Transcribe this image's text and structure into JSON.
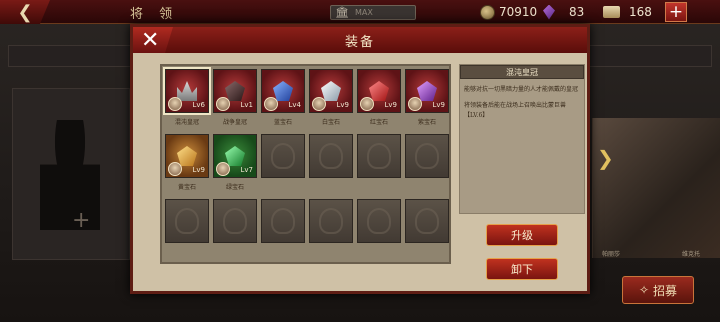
{
  "topbar": {
    "back_icon": "back-arrow-icon",
    "title": "将 领",
    "capacity_text": "MAX",
    "resources": {
      "coins": "70910",
      "gems": "83",
      "scrolls": "168"
    },
    "add_label": "+"
  },
  "background": {
    "add_slot_label": "+",
    "hero_labels": [
      "帕丽莎",
      "维克托"
    ],
    "recruit_label": "招募"
  },
  "modal": {
    "title": "装备",
    "close_label": "✕",
    "items": [
      {
        "name": "混沌皇冠",
        "level": "Lv6",
        "shape": "crown",
        "color": "red",
        "selected": true
      },
      {
        "name": "战争皇冠",
        "level": "Lv1",
        "shape": "dark",
        "color": "red",
        "selected": false
      },
      {
        "name": "蓝宝石",
        "level": "Lv4",
        "shape": "blue",
        "color": "red",
        "selected": false
      },
      {
        "name": "白宝石",
        "level": "Lv9",
        "shape": "white",
        "color": "red",
        "selected": false
      },
      {
        "name": "红宝石",
        "level": "Lv9",
        "shape": "red",
        "color": "red",
        "selected": false
      },
      {
        "name": "紫宝石",
        "level": "Lv9",
        "shape": "purple",
        "color": "red",
        "selected": false
      },
      {
        "name": "黄宝石",
        "level": "Lv9",
        "shape": "yellow",
        "color": "gold",
        "selected": false
      },
      {
        "name": "绿宝石",
        "level": "Lv7",
        "shape": "green",
        "color": "green",
        "selected": false
      }
    ],
    "empty_slots": 10,
    "details": {
      "title": "混沌皇冠",
      "desc1": "能够对抗一切黑暗力量的人才能佩戴的皇冠",
      "desc2": "将领装备后能在战场上召唤出比蒙巨兽【LV.6】"
    },
    "upgrade_label": "升级",
    "unequip_label": "卸下"
  }
}
